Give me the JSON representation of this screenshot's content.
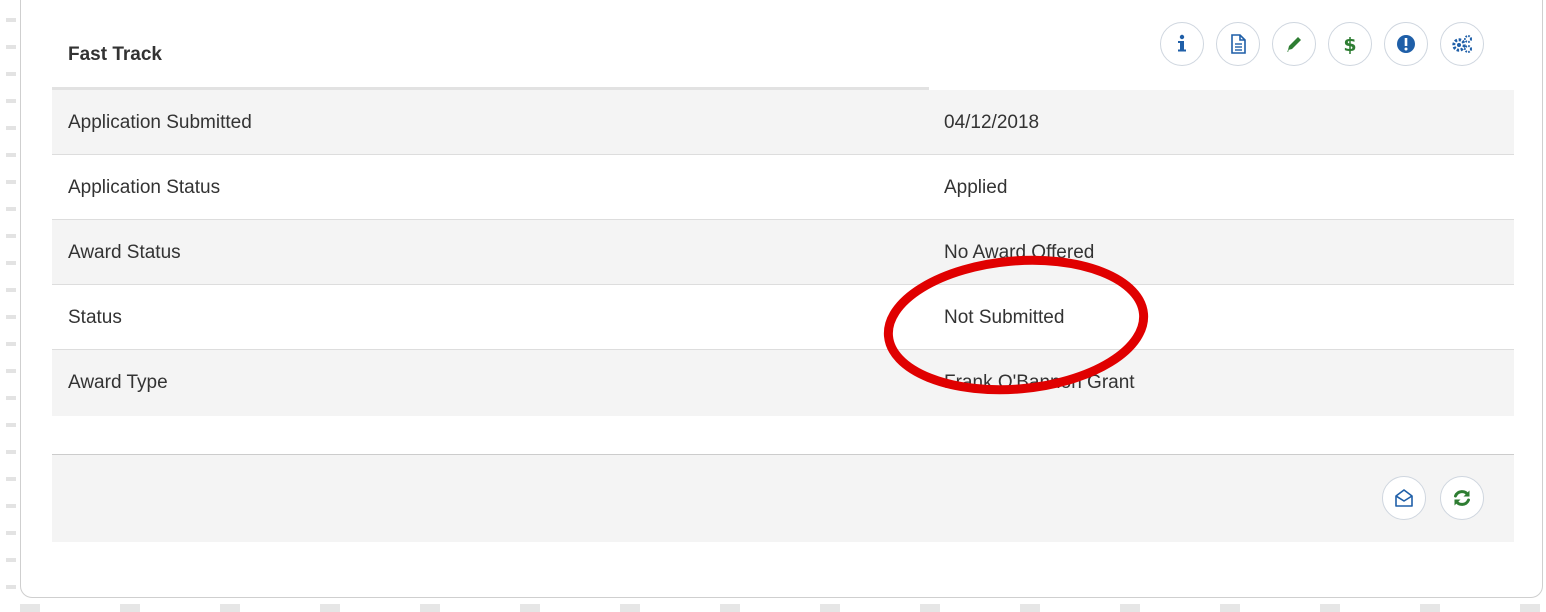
{
  "panel": {
    "title": "Fast Track"
  },
  "header_icons": [
    {
      "name": "info-icon",
      "color": "#1f5fa8"
    },
    {
      "name": "document-icon",
      "color": "#1f5fa8"
    },
    {
      "name": "pencil-icon",
      "color": "#2e7d32"
    },
    {
      "name": "dollar-icon",
      "color": "#2e7d32"
    },
    {
      "name": "alert-icon",
      "color": "#1f5fa8"
    },
    {
      "name": "gears-icon",
      "color": "#1f5fa8"
    }
  ],
  "rows": [
    {
      "label": "Application Submitted",
      "value": "04/12/2018"
    },
    {
      "label": "Application Status",
      "value": "Applied"
    },
    {
      "label": "Award Status",
      "value": "No Award Offered"
    },
    {
      "label": "Status",
      "value": "Not Submitted"
    },
    {
      "label": "Award Type",
      "value": "Frank O'Bannon Grant"
    }
  ],
  "footer_icons": [
    {
      "name": "envelope-open-icon",
      "color": "#1f5fa8"
    },
    {
      "name": "refresh-icon",
      "color": "#2e7d32"
    }
  ],
  "annotation": {
    "shape": "ellipse",
    "color": "#e00000",
    "target": "Not Submitted"
  }
}
